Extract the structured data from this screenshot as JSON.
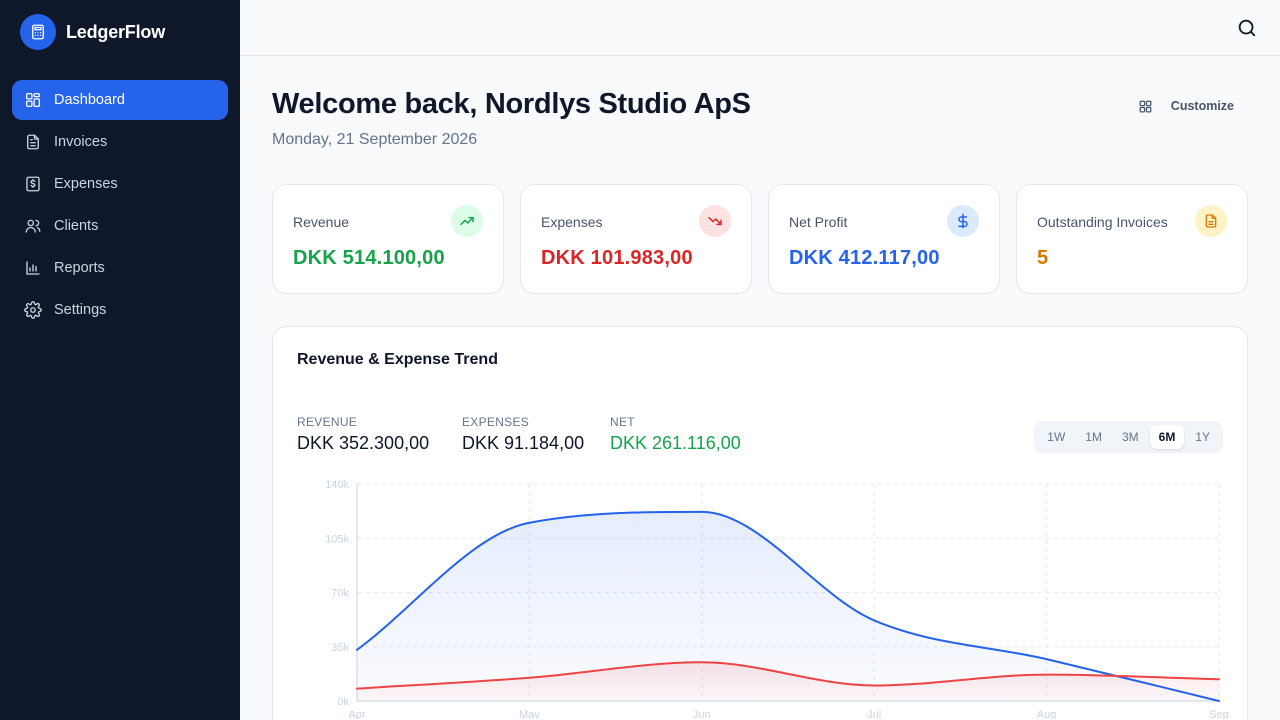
{
  "app": {
    "name": "LedgerFlow",
    "logo_icon": "calculator-icon"
  },
  "sidebar": {
    "items": [
      {
        "label": "Dashboard",
        "icon": "dashboard-icon",
        "active": true
      },
      {
        "label": "Invoices",
        "icon": "invoice-icon",
        "active": false
      },
      {
        "label": "Expenses",
        "icon": "dollar-receipt-icon",
        "active": false
      },
      {
        "label": "Clients",
        "icon": "users-icon",
        "active": false
      },
      {
        "label": "Reports",
        "icon": "bar-chart-icon",
        "active": false
      },
      {
        "label": "Settings",
        "icon": "gear-icon",
        "active": false
      }
    ]
  },
  "header": {
    "welcome": "Welcome back, Nordlys Studio ApS",
    "date": "Monday, 21 September 2026",
    "customize_label": "Customize"
  },
  "kpis": [
    {
      "label": "Revenue",
      "value": "DKK 514.100,00",
      "color": "#16a34a",
      "icon": "trending-up-icon",
      "icon_bg": "#dcfce7"
    },
    {
      "label": "Expenses",
      "value": "DKK 101.983,00",
      "color": "#dc2626",
      "icon": "trending-down-icon",
      "icon_bg": "#fee2e2"
    },
    {
      "label": "Net Profit",
      "value": "DKK 412.117,00",
      "color": "#2563eb",
      "icon": "dollar-icon",
      "icon_bg": "#dbeafe"
    },
    {
      "label": "Outstanding Invoices",
      "value": "5",
      "color": "#d97706",
      "icon": "document-icon",
      "icon_bg": "#fef3c7"
    }
  ],
  "trend": {
    "title": "Revenue & Expense Trend",
    "stats": [
      {
        "label": "REVENUE",
        "value": "DKK 352.300,00",
        "color": "#0f172a"
      },
      {
        "label": "EXPENSES",
        "value": "DKK 91.184,00",
        "color": "#0f172a"
      },
      {
        "label": "NET",
        "value": "DKK 261.116,00",
        "color": "#16a34a"
      }
    ],
    "ranges": [
      "1W",
      "1M",
      "3M",
      "6M",
      "1Y"
    ],
    "active_range": "6M"
  },
  "chart_data": {
    "type": "area",
    "x": [
      "Apr",
      "May",
      "Jun",
      "Jul",
      "Aug",
      "Sep"
    ],
    "series": [
      {
        "values": [
          33000,
          115000,
          122000,
          52000,
          27000,
          0
        ],
        "color": "#2563eb"
      },
      {
        "values": [
          8000,
          15000,
          25000,
          10000,
          17000,
          14000
        ],
        "color": "#ef4444"
      }
    ],
    "y_ticks": [
      "0k",
      "35k",
      "70k",
      "105k",
      "140k"
    ],
    "ylim": [
      0,
      140000
    ],
    "grid": true
  }
}
